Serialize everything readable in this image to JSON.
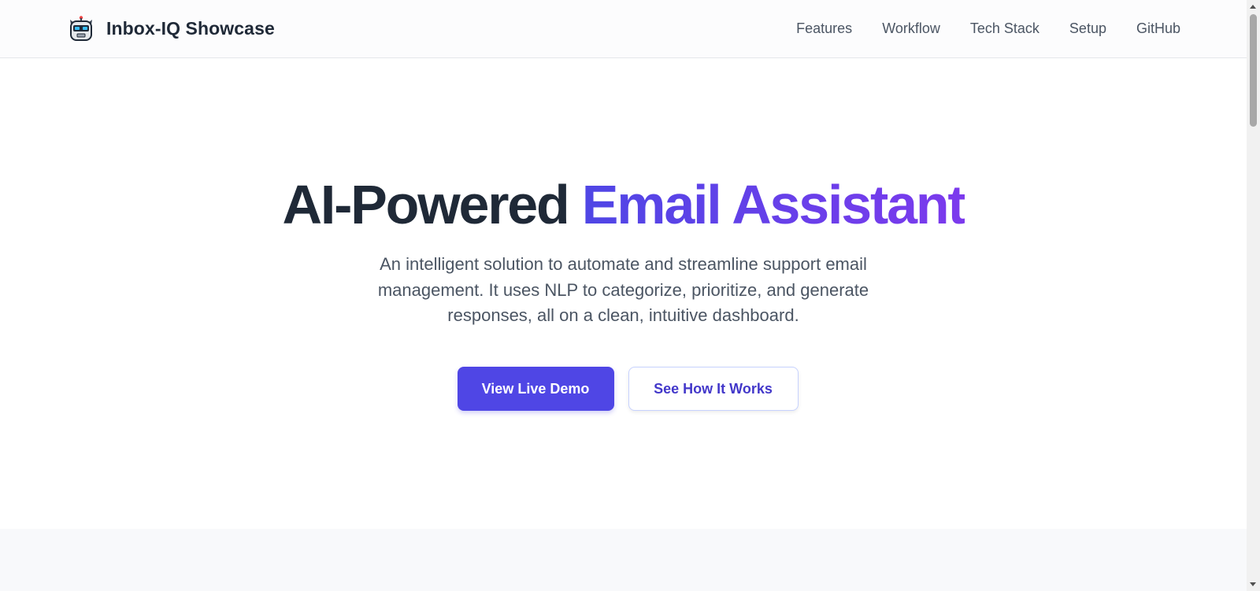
{
  "header": {
    "brand_name": "Inbox-IQ Showcase",
    "logo_icon": "robot-icon",
    "nav": [
      {
        "label": "Features"
      },
      {
        "label": "Workflow"
      },
      {
        "label": "Tech Stack"
      },
      {
        "label": "Setup"
      },
      {
        "label": "GitHub"
      }
    ]
  },
  "hero": {
    "title_dark": "AI-Powered",
    "title_accent": "Email Assistant",
    "subtitle": "An intelligent solution to automate and streamline support email management. It uses NLP to categorize, prioritize, and generate responses, all on a clean, intuitive dashboard.",
    "primary_button": "View Live Demo",
    "secondary_button": "See How It Works"
  },
  "colors": {
    "accent_start": "#4f46e5",
    "accent_end": "#7c3aed",
    "primary_button_bg": "#4f46e5",
    "text_dark": "#1f2937",
    "text_muted": "#4b5563"
  }
}
